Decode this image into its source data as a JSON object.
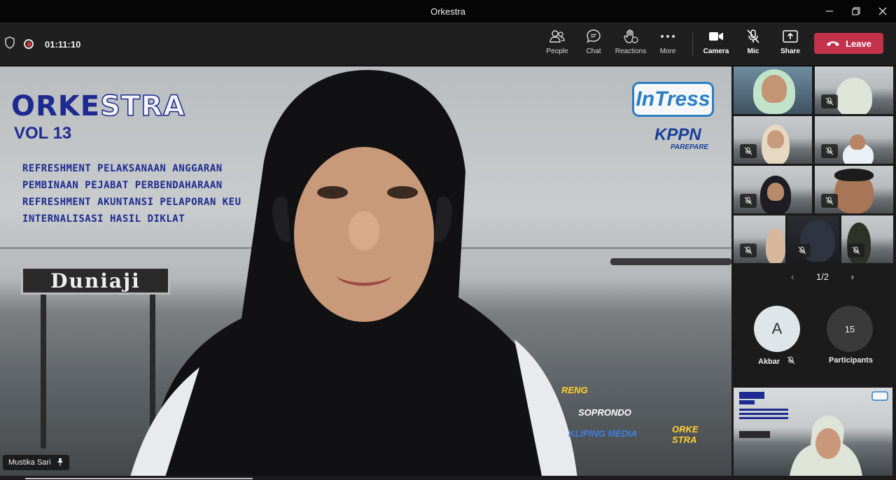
{
  "window": {
    "title": "Orkestra",
    "controls": [
      "minimize-icon",
      "restore-icon",
      "close-icon"
    ]
  },
  "toolbar": {
    "timer": "01:11:10",
    "buttons": [
      {
        "label": "People",
        "icon": "people-icon"
      },
      {
        "label": "Chat",
        "icon": "chat-icon"
      },
      {
        "label": "Reactions",
        "icon": "reactions-icon"
      },
      {
        "label": "More",
        "icon": "more-icon"
      },
      {
        "label": "Camera",
        "icon": "camera-icon"
      },
      {
        "label": "Mic",
        "icon": "mic-off-icon"
      },
      {
        "label": "Share",
        "icon": "share-icon"
      }
    ],
    "leave_label": "Leave",
    "leave_color": "#c4314b"
  },
  "stage": {
    "banner": {
      "title_part1": "ORKE",
      "title_part2": "STRA",
      "subtitle": "VOL 13",
      "topics": [
        "REFRESHMENT PELAKSANAAN ANGGARAN",
        "PEMBINAAN PEJABAT PERBENDAHARAAN",
        "REFRESHMENT AKUNTANSI PELAPORAN KEU",
        "INTERNALISASI HASIL DIKLAT"
      ],
      "logo_intress": "InTress",
      "logo_kppn": "KPPN",
      "logo_city": "PAREPARE",
      "sign_text": "Duniaji",
      "sponsors": [
        "RENG",
        "SOPRONDO",
        "KLIPING MEDIA",
        "ORKE STRA"
      ]
    },
    "speaker_name": "Mustika Sari",
    "accent_color": "#1d2a8f"
  },
  "gallery": {
    "page_indicator": "1/2",
    "tile_count": 9
  },
  "participants_area": {
    "avatar_initial": "A",
    "avatar_name": "Akbar",
    "participant_count": "15",
    "participant_label": "Participants"
  }
}
